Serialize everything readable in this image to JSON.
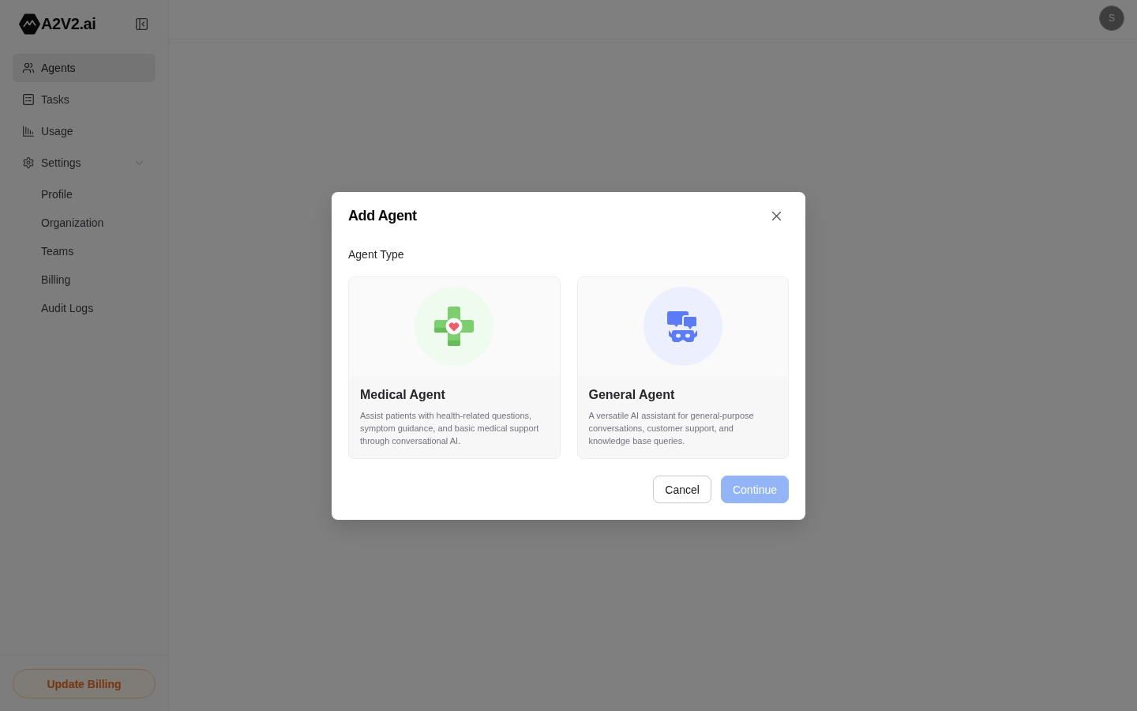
{
  "sidebar": {
    "brand": "A2V2.ai",
    "nav": [
      {
        "label": "Agents",
        "selected": true
      },
      {
        "label": "Tasks",
        "selected": false
      },
      {
        "label": "Usage",
        "selected": false
      },
      {
        "label": "Settings",
        "selected": false,
        "expanded": true,
        "children": [
          {
            "label": "Profile",
            "selected": false
          },
          {
            "label": "Organization",
            "selected": false
          },
          {
            "label": "Teams",
            "selected": false
          },
          {
            "label": "Billing",
            "selected": false
          },
          {
            "label": "Audit Logs",
            "selected": false
          }
        ]
      }
    ],
    "footer_button": "Update Billing"
  },
  "header": {
    "avatar": "S"
  },
  "dialog": {
    "title": "Add Agent",
    "section_label": "Agent Type",
    "options": [
      {
        "kind": "medical",
        "title": "Medical Agent",
        "description": "Assist patients with health-related questions, symptom guidance, and basic medical support through conversational AI.",
        "selected": false
      },
      {
        "kind": "general",
        "title": "General Agent",
        "description": "A versatile AI assistant for general-purpose conversations, customer support, and knowledge base queries.",
        "selected": false
      }
    ],
    "buttons": [
      {
        "kind": "secondary",
        "label": "Cancel",
        "disabled": false
      },
      {
        "kind": "primary",
        "label": "Continue",
        "disabled": true
      }
    ]
  }
}
